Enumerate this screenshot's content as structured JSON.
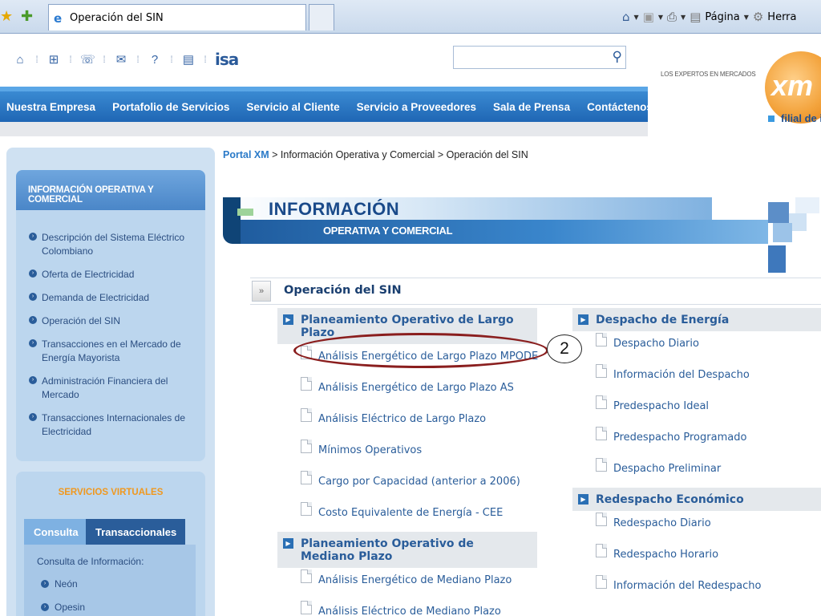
{
  "browser": {
    "tab_title": "Operación del SIN",
    "page_menu": "Página",
    "tools_menu": "Herra"
  },
  "header": {
    "isa_logo_text": "isa",
    "search_placeholder": "",
    "brand_tagline": "LOS EXPERTOS EN MERCADOS",
    "brand_logo_text": "xm",
    "brand_sub": "filial de i"
  },
  "nav": {
    "items": [
      "Nuestra Empresa",
      "Portafolio de Servicios",
      "Servicio al Cliente",
      "Servicio a Proveedores",
      "Sala de Prensa",
      "Contáctenos"
    ]
  },
  "sidebar": {
    "title": "INFORMACIÓN OPERATIVA Y COMERCIAL",
    "items": [
      "Descripción del Sistema Eléctrico Colombiano",
      "Oferta de Electricidad",
      "Demanda de Electricidad",
      "Operación del SIN",
      "Transacciones en el Mercado de Energía Mayorista",
      "Administración Financiera del Mercado",
      "Transacciones Internacionales de Electricidad"
    ]
  },
  "virtual": {
    "title": "SERVICIOS VIRTUALES",
    "tabs": [
      "Consulta",
      "Transaccionales"
    ],
    "body_label": "Consulta de Información:",
    "items": [
      "Neón",
      "Opesin"
    ]
  },
  "breadcrumb": {
    "root": "Portal XM",
    "sep": " > ",
    "level1": "Información Operativa y Comercial",
    "level2": "Operación del SIN"
  },
  "banner": {
    "title": "INFORMACIÓN",
    "subtitle": "OPERATIVA Y COMERCIAL"
  },
  "section": {
    "title": "Operación del SIN"
  },
  "left_column": {
    "group1_title": "Planeamiento Operativo de Largo Plazo",
    "group1_items": [
      "Análisis Energético de Largo Plazo MPODE",
      "Análisis Energético de Largo Plazo AS",
      "Análisis Eléctrico de Largo Plazo",
      "Mínimos Operativos",
      "Cargo por Capacidad (anterior a 2006)",
      "Costo Equivalente de Energía - CEE"
    ],
    "group2_title": "Planeamiento Operativo de Mediano Plazo",
    "group2_items": [
      "Análisis Energético de Mediano Plazo",
      "Análisis Eléctrico de Mediano Plazo"
    ]
  },
  "right_column": {
    "group1_title": "Despacho de Energía",
    "group1_items": [
      "Despacho Diario",
      "Información del Despacho",
      "Predespacho Ideal",
      "Predespacho Programado",
      "Despacho Preliminar"
    ],
    "group2_title": "Redespacho Económico",
    "group2_items": [
      "Redespacho Diario",
      "Redespacho Horario",
      "Información del Redespacho"
    ]
  },
  "annotation": {
    "number": "2",
    "color": "#8a1e1e"
  }
}
